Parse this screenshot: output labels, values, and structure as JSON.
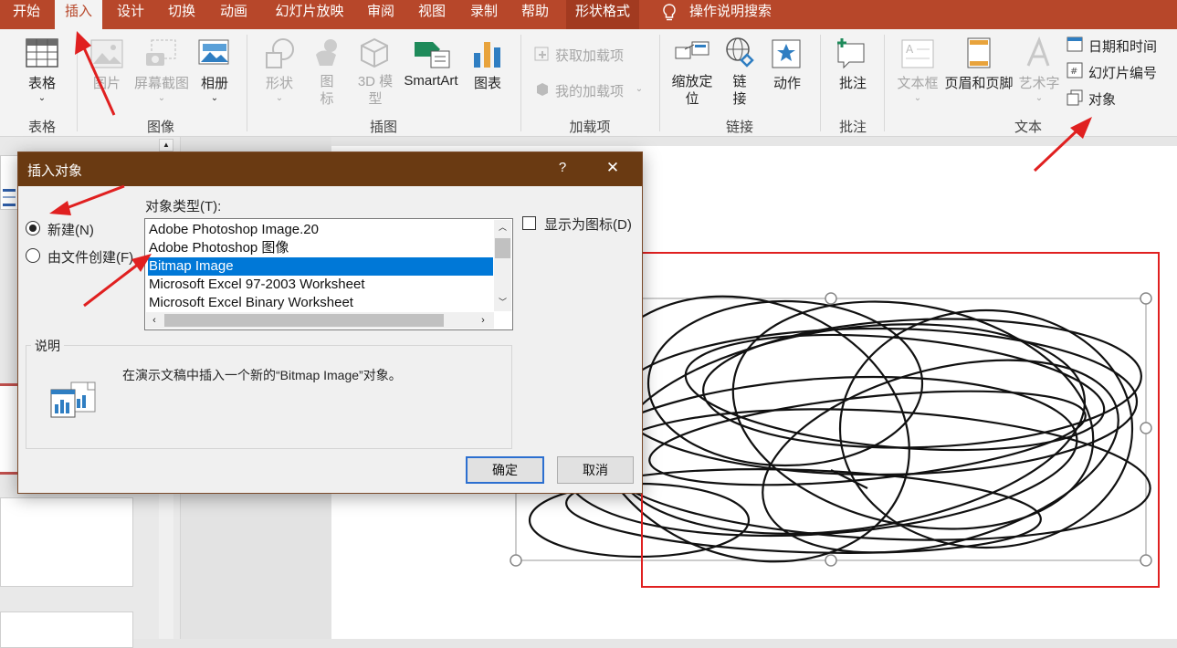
{
  "tabs": [
    "开始",
    "插入",
    "设计",
    "切换",
    "动画",
    "幻灯片放映",
    "审阅",
    "视图",
    "录制",
    "帮助",
    "形状格式"
  ],
  "active_tab": "插入",
  "search_label": "操作说明搜索",
  "ribbon": {
    "table": {
      "label": "表格",
      "group": "表格"
    },
    "images": {
      "picture": "图片",
      "screenshot": "屏幕截图",
      "album": "相册",
      "group": "图像"
    },
    "illustrations": {
      "shapes": "形状",
      "icons": "图标",
      "model3d": "3D 模型",
      "smartart": "SmartArt",
      "chart": "图表",
      "group": "插图"
    },
    "addins": {
      "get": "获取加载项",
      "mine": "我的加载项",
      "group": "加载项"
    },
    "links": {
      "zoom": "缩放定位",
      "link": "链接",
      "action": "动作",
      "group": "链接"
    },
    "comments": {
      "comment": "批注",
      "group": "批注"
    },
    "text": {
      "textbox": "文本框",
      "header_footer": "页眉和页脚",
      "wordart": "艺术字",
      "datetime": "日期和时间",
      "slide_number": "幻灯片编号",
      "object": "对象",
      "group": "文本"
    }
  },
  "dialog": {
    "title": "插入对象",
    "help": "?",
    "close": "✕",
    "radio_new": "新建(N)",
    "radio_from_file": "由文件创建(F)",
    "object_type_label": "对象类型(T):",
    "object_types": [
      "Adobe Photoshop Image.20",
      "Adobe Photoshop 图像",
      "Bitmap Image",
      "Microsoft Excel 97-2003 Worksheet",
      "Microsoft Excel Binary Worksheet"
    ],
    "selected_index": 2,
    "display_as_icon": "显示为图标(D)",
    "description_label": "说明",
    "description_text": "在演示文稿中插入一个新的“Bitmap Image”对象。",
    "ok": "确定",
    "cancel": "取消"
  },
  "colors": {
    "accent": "#b7472a",
    "dialog_title": "#6a3a12",
    "selection": "#0078d7",
    "annotation_red": "#e02020"
  }
}
